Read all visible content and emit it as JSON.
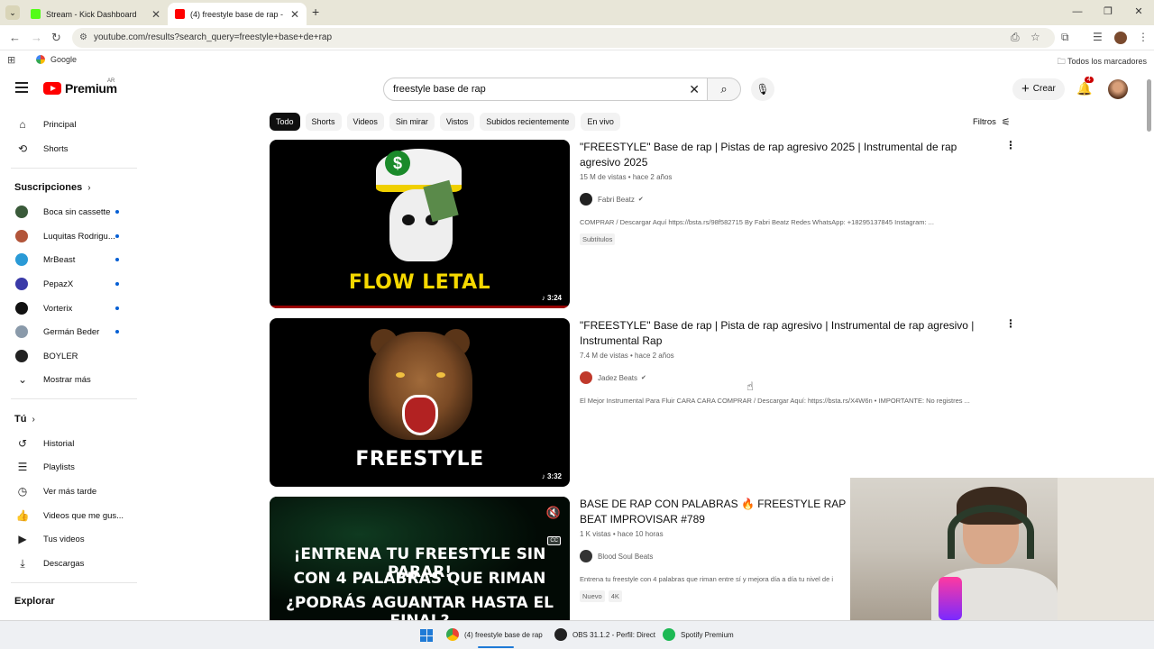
{
  "browser": {
    "tabs": [
      {
        "title": "Stream - Kick Dashboard",
        "favicon_color": "#53fc18"
      },
      {
        "title": "(4) freestyle base de rap - YouTube",
        "favicon_color": "#ff0000"
      }
    ],
    "url": "youtube.com/results?search_query=freestyle+base+de+rap",
    "bookmarks": {
      "google": "Google",
      "all": "Todos los marcadores"
    }
  },
  "youtube": {
    "logo_text": "Premium",
    "region": "AR",
    "search_value": "freestyle base de rap",
    "create_label": "Crear",
    "notifications": "4"
  },
  "sidebar": {
    "main": [
      {
        "label": "Principal",
        "icon": "home-icon"
      },
      {
        "label": "Shorts",
        "icon": "shorts-icon"
      }
    ],
    "subs_header": "Suscripciones",
    "subscriptions": [
      {
        "label": "Boca sin cassette",
        "color": "#3a5a3a"
      },
      {
        "label": "Luquitas Rodrigu...",
        "color": "#b2553a"
      },
      {
        "label": "MrBeast",
        "color": "#2a9ad6"
      },
      {
        "label": "PepazX",
        "color": "#3a3aa8"
      },
      {
        "label": "Vorterix",
        "color": "#111111"
      },
      {
        "label": "Germán Beder",
        "color": "#8a9aaa"
      },
      {
        "label": "BOYLER",
        "color": "#222222"
      }
    ],
    "show_more": "Mostrar más",
    "you_header": "Tú",
    "you": [
      {
        "label": "Historial",
        "icon": "history-icon"
      },
      {
        "label": "Playlists",
        "icon": "playlist-icon"
      },
      {
        "label": "Ver más tarde",
        "icon": "clock-icon"
      },
      {
        "label": "Videos que me gus...",
        "icon": "like-icon"
      },
      {
        "label": "Tus videos",
        "icon": "video-icon"
      },
      {
        "label": "Descargas",
        "icon": "download-icon"
      }
    ],
    "explore_header": "Explorar"
  },
  "chips": [
    "Todo",
    "Shorts",
    "Videos",
    "Sin mirar",
    "Vistos",
    "Subidos recientemente",
    "En vivo"
  ],
  "filters_label": "Filtros",
  "results": [
    {
      "title": "\"FREESTYLE\" Base de rap | Pistas de rap agresivo 2025 | Instrumental de rap agresivo 2025",
      "meta": "15 M de vistas • hace 2 años",
      "channel": "Fabri Beatz",
      "channel_color": "#222222",
      "description": "COMPRAR / Descargar Aquí https://bsta.rs/98f582715 By Fabri Beatz Redes WhatsApp: +18295137845 Instagram: ...",
      "badges": [
        "Subtítulos"
      ],
      "duration": "3:24",
      "thumb_text": "FLOW LETAL"
    },
    {
      "title": "\"FREESTYLE\" Base de rap | Pista de rap agresivo | Instrumental de rap agresivo | Instrumental Rap",
      "meta": "7.4 M de vistas • hace 2 años",
      "channel": "Jadez Beats",
      "channel_color": "#c0392b",
      "description": "El Mejor Instrumental Para Fluir CARA CARA COMPRAR / Descargar Aquí: https://bsta.rs/X4W6n • IMPORTANTE: No registres ...",
      "badges": [],
      "duration": "3:32",
      "thumb_text": "FREESTYLE"
    },
    {
      "title": "BASE DE RAP CON PALABRAS 🔥 FREESTYLE RAP BEAT IMPROVISAR #789",
      "meta": "1 K vistas • hace 10 horas",
      "channel": "Blood Soul Beats",
      "channel_color": "#333333",
      "description": "Entrena tu freestyle con 4 palabras que riman entre sí y mejora día a día tu nivel de i",
      "badges": [
        "Nuevo",
        "4K"
      ],
      "thumb_lines": [
        "¡ENTRENA TU FREESTYLE SIN PARAR!",
        "CON 4 PALABRAS QUE RIMAN",
        "¿PODRÁS AGUANTAR HASTA EL FINAL?"
      ]
    }
  ],
  "taskbar": [
    {
      "label": "(4) freestyle base de rap",
      "color": "#ea4335"
    },
    {
      "label": "OBS 31.1.2 - Perfil: Direct",
      "color": "#222222"
    },
    {
      "label": "Spotify Premium",
      "color": "#1db954"
    }
  ]
}
